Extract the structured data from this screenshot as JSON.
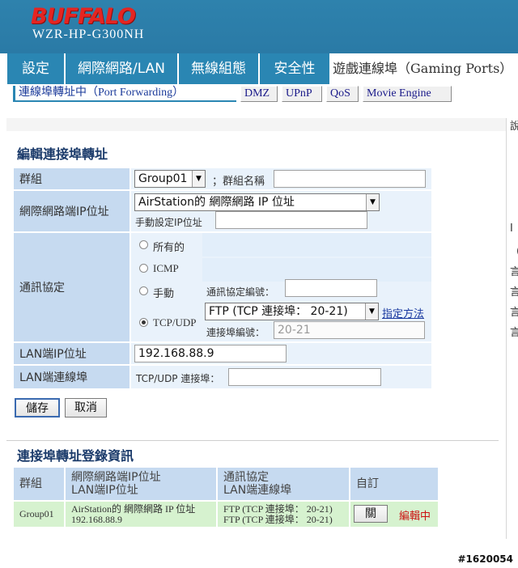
{
  "header": {
    "brand": "BUFFALO",
    "model": "WZR-HP-G300NH"
  },
  "tabs": [
    {
      "label": "設定"
    },
    {
      "label": "網際網路/LAN"
    },
    {
      "label": "無線組態"
    },
    {
      "label": "安全性"
    },
    {
      "label": "遊戲連線埠（Gaming Ports）"
    }
  ],
  "subtabs": [
    {
      "label": "連線埠轉址中（Port Forwarding）"
    },
    {
      "label": "DMZ"
    },
    {
      "label": "UPnP"
    },
    {
      "label": "QoS"
    },
    {
      "label": "Movie Engine"
    }
  ],
  "edit": {
    "title": "編輯連接埠轉址",
    "group": {
      "label": "群組",
      "value": "Group01",
      "name_label": "；群組名稱",
      "name_value": ""
    },
    "wan_ip": {
      "label": "網際網路端IP位址",
      "value": "AirStation的 網際網路 IP 位址",
      "manual_label": "手動設定IP位址",
      "manual_value": ""
    },
    "protocol": {
      "label": "通訊協定",
      "all": "所有的",
      "icmp": "ICMP",
      "manual": "手動",
      "manual_no_label": "通訊協定編號：",
      "manual_no_value": "",
      "tcpudp": "TCP/UDP",
      "tcpudp_value": "FTP (TCP 連接埠： 20-21)",
      "specify_link": "指定方法",
      "port_label": "連接埠編號：",
      "port_value": "20-21",
      "selected": "tcpudp"
    },
    "lan_ip": {
      "label": "LAN端IP位址",
      "value": "192.168.88.9"
    },
    "lan_port": {
      "label": "LAN端連線埠",
      "tcpudp_label": "TCP/UDP 連接埠：",
      "value": ""
    },
    "save_label": "儲存",
    "cancel_label": "取消"
  },
  "list": {
    "title": "連接埠轉址登錄資訊",
    "headers": {
      "group": "群組",
      "wan_ip": "網際網路端IP位址",
      "lan_ip": "LAN端IP位址",
      "protocol": "通訊協定",
      "lan_port": "LAN端連線埠",
      "custom": "自訂"
    },
    "rows": [
      {
        "group": "Group01",
        "wan_ip": "AirStation的 網際網路 IP 位址",
        "lan_ip": "192.168.88.9",
        "protocol": "FTP (TCP 連接埠： 20-21)",
        "lan_port": "FTP (TCP 連接埠： 20-21)",
        "action": "關",
        "status": "編輯中"
      }
    ]
  },
  "watermark": "#1620054",
  "colors": {
    "header_bg": "#2e82ad",
    "brand": "#e52521",
    "label_bg": "#c6daf0",
    "row_bg": "#d6f2cf",
    "status_red": "#cc1111"
  }
}
